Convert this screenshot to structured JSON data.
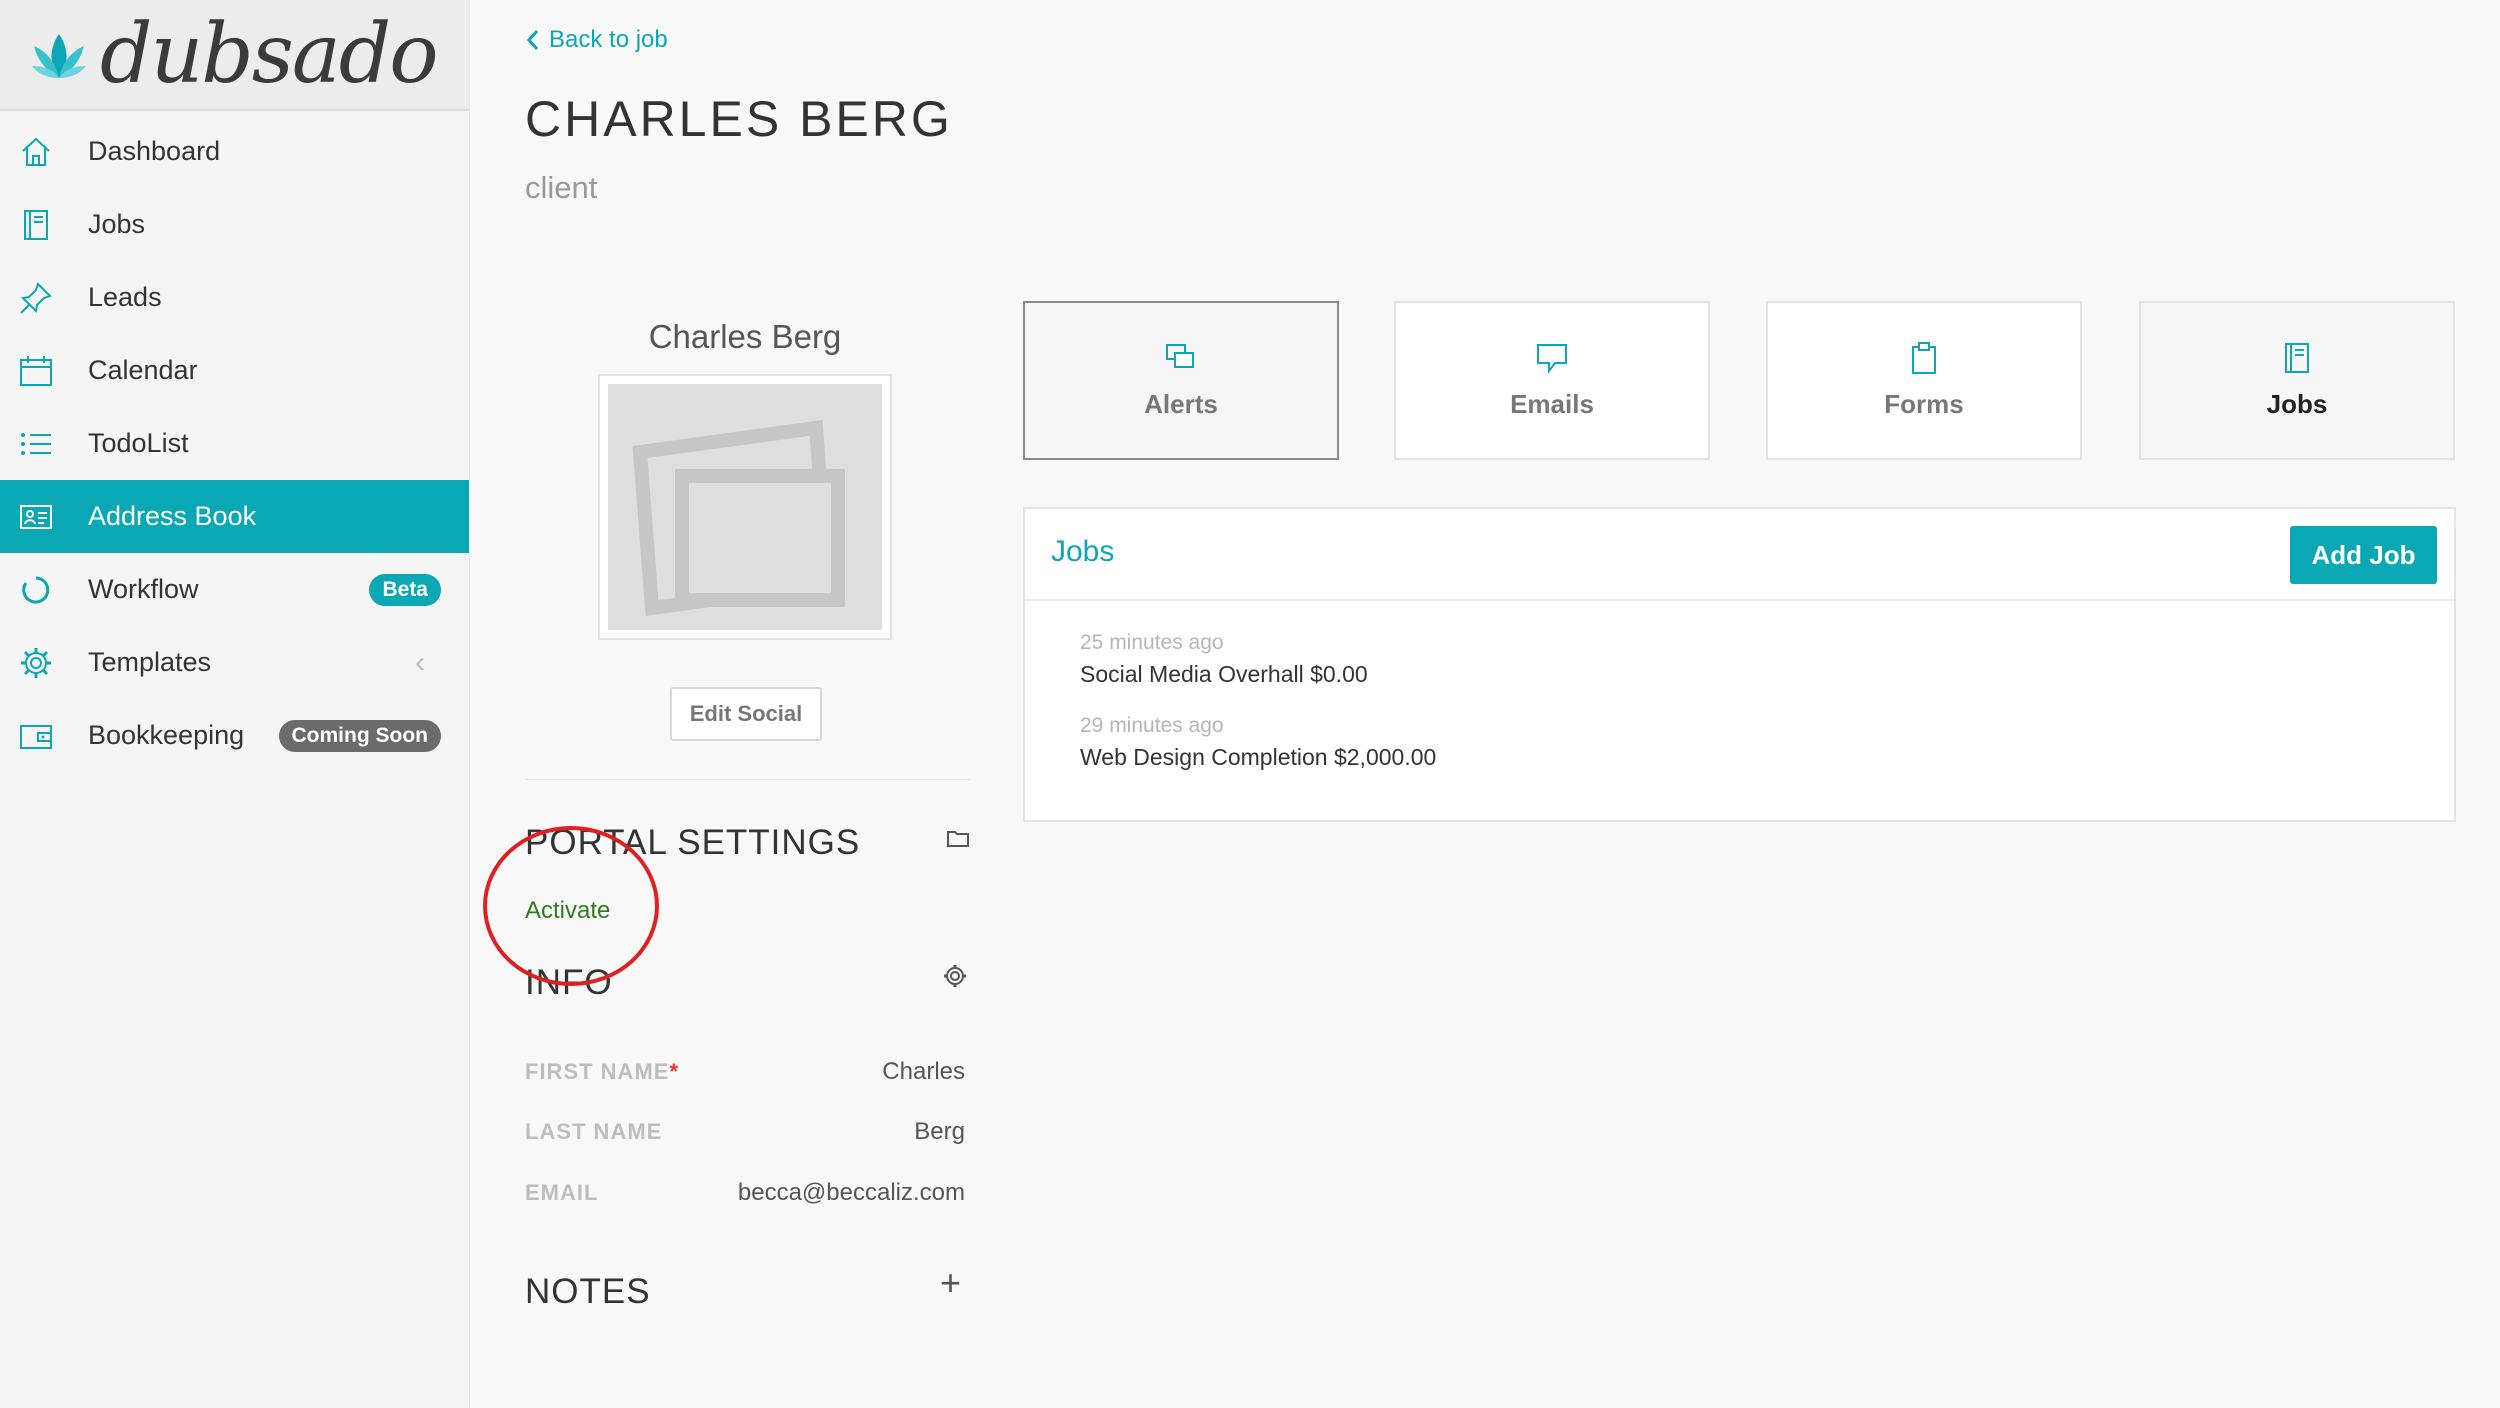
{
  "logo": {
    "text": "dubsado"
  },
  "sidebar": {
    "items": [
      {
        "label": "Dashboard",
        "icon": "home-icon"
      },
      {
        "label": "Jobs",
        "icon": "notebook-icon"
      },
      {
        "label": "Leads",
        "icon": "pin-icon"
      },
      {
        "label": "Calendar",
        "icon": "calendar-icon"
      },
      {
        "label": "TodoList",
        "icon": "list-icon"
      },
      {
        "label": "Address Book",
        "icon": "contact-card-icon",
        "active": true
      },
      {
        "label": "Workflow",
        "icon": "loop-icon",
        "badge": "Beta"
      },
      {
        "label": "Templates",
        "icon": "gear-icon"
      },
      {
        "label": "Bookkeeping",
        "icon": "wallet-icon",
        "badge": "Coming Soon"
      }
    ]
  },
  "header": {
    "back_label": "Back to job",
    "title": "CHARLES BERG",
    "subtitle": "client"
  },
  "profile": {
    "name": "Charles Berg",
    "edit_social_label": "Edit Social"
  },
  "portal": {
    "title": "PORTAL SETTINGS",
    "activate_label": "Activate"
  },
  "info": {
    "title": "INFO",
    "fields": [
      {
        "label": "FIRST NAME",
        "required": "*",
        "value": "Charles"
      },
      {
        "label": "LAST NAME",
        "value": "Berg"
      },
      {
        "label": "EMAIL",
        "value": "becca@beccaliz.com"
      }
    ]
  },
  "notes": {
    "title": "NOTES",
    "add_symbol": "+"
  },
  "tabs": [
    {
      "label": "Alerts",
      "icon": "alerts-icon"
    },
    {
      "label": "Emails",
      "icon": "chat-bubble-icon"
    },
    {
      "label": "Forms",
      "icon": "clipboard-icon"
    },
    {
      "label": "Jobs",
      "icon": "notebook-icon"
    }
  ],
  "jobs_panel": {
    "title": "Jobs",
    "add_label": "Add Job",
    "jobs": [
      {
        "time": "25 minutes ago",
        "title": "Social Media Overhall $0.00"
      },
      {
        "time": "29 minutes ago",
        "title": "Web Design Completion $2,000.00"
      }
    ]
  },
  "colors": {
    "accent": "#0aa7b5",
    "activate": "#2f7a1f",
    "annotation": "#e02020",
    "badge_soon": "#6b6b6b"
  }
}
